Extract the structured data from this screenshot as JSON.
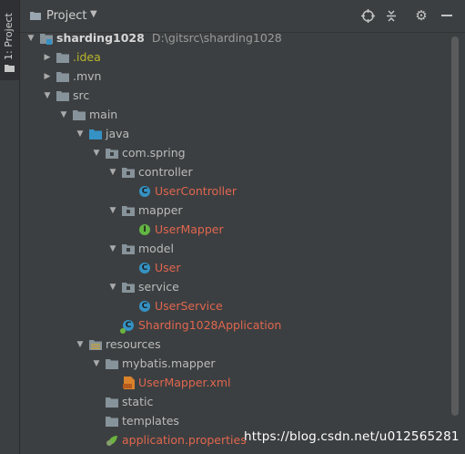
{
  "sidebar": {
    "tab_label": "1: Project"
  },
  "header": {
    "title": "Project"
  },
  "tree": [
    {
      "label": "sharding1028",
      "path": "D:\\gitsrc\\sharding1028",
      "icon": "module-folder-icon",
      "arrow": "down",
      "depth": 0,
      "color": "bold"
    },
    {
      "label": ".idea",
      "icon": "folder-icon",
      "arrow": "right",
      "depth": 1,
      "color": "olive"
    },
    {
      "label": ".mvn",
      "icon": "folder-icon",
      "arrow": "right",
      "depth": 1,
      "color": "normal"
    },
    {
      "label": "src",
      "icon": "folder-icon",
      "arrow": "down",
      "depth": 1,
      "color": "normal"
    },
    {
      "label": "main",
      "icon": "folder-icon",
      "arrow": "down",
      "depth": 2,
      "color": "normal"
    },
    {
      "label": "java",
      "icon": "source-folder-icon",
      "arrow": "down",
      "depth": 3,
      "color": "normal"
    },
    {
      "label": "com.spring",
      "icon": "package-icon",
      "arrow": "down",
      "depth": 4,
      "color": "normal"
    },
    {
      "label": "controller",
      "icon": "package-icon",
      "arrow": "down",
      "depth": 5,
      "color": "normal"
    },
    {
      "label": "UserController",
      "icon": "class-icon",
      "arrow": "",
      "depth": 6,
      "color": "red"
    },
    {
      "label": "mapper",
      "icon": "package-icon",
      "arrow": "down",
      "depth": 5,
      "color": "normal"
    },
    {
      "label": "UserMapper",
      "icon": "interface-icon",
      "arrow": "",
      "depth": 6,
      "color": "red"
    },
    {
      "label": "model",
      "icon": "package-icon",
      "arrow": "down",
      "depth": 5,
      "color": "normal"
    },
    {
      "label": "User",
      "icon": "class-icon",
      "arrow": "",
      "depth": 6,
      "color": "red"
    },
    {
      "label": "service",
      "icon": "package-icon",
      "arrow": "down",
      "depth": 5,
      "color": "normal"
    },
    {
      "label": "UserService",
      "icon": "class-icon",
      "arrow": "",
      "depth": 6,
      "color": "red"
    },
    {
      "label": "Sharding1028Application",
      "icon": "spring-boot-class-icon",
      "arrow": "",
      "depth": 5,
      "color": "red"
    },
    {
      "label": "resources",
      "icon": "resources-folder-icon",
      "arrow": "down",
      "depth": 3,
      "color": "normal"
    },
    {
      "label": "mybatis.mapper",
      "icon": "folder-icon",
      "arrow": "down",
      "depth": 4,
      "color": "normal"
    },
    {
      "label": "UserMapper.xml",
      "icon": "xml-file-icon",
      "arrow": "",
      "depth": 5,
      "color": "red"
    },
    {
      "label": "static",
      "icon": "folder-icon",
      "arrow": "",
      "depth": 4,
      "color": "normal"
    },
    {
      "label": "templates",
      "icon": "folder-icon",
      "arrow": "",
      "depth": 4,
      "color": "normal"
    },
    {
      "label": "application.properties",
      "icon": "properties-file-icon",
      "arrow": "",
      "depth": 4,
      "color": "red"
    }
  ],
  "watermark": "https://blog.csdn.net/u012565281"
}
